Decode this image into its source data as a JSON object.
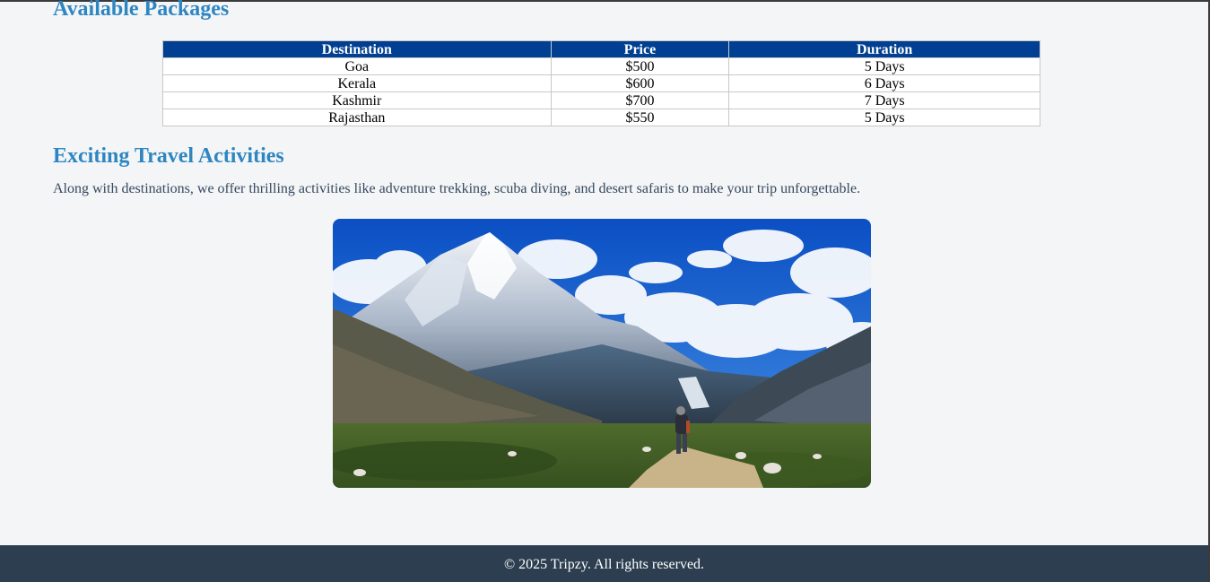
{
  "packages": {
    "title": "Available Packages",
    "columns": [
      "Destination",
      "Price",
      "Duration"
    ],
    "rows": [
      {
        "destination": "Goa",
        "price": "$500",
        "duration": "5 Days"
      },
      {
        "destination": "Kerala",
        "price": "$600",
        "duration": "6 Days"
      },
      {
        "destination": "Kashmir",
        "price": "$700",
        "duration": "7 Days"
      },
      {
        "destination": "Rajasthan",
        "price": "$550",
        "duration": "5 Days"
      }
    ],
    "colors": {
      "header_bg": "#003f91",
      "header_text": "#ffffff",
      "border": "#c8c8c8"
    }
  },
  "activities": {
    "title": "Exciting Travel Activities",
    "description": "Along with destinations, we offer thrilling activities like adventure trekking, scuba diving, and desert safaris to make your trip unforgettable.",
    "image_subject": "hiker on mountain trail with snowy peak"
  },
  "footer": {
    "text": "© 2025 Tripzy. All rights reserved."
  },
  "theme": {
    "heading_color": "#2e86c1",
    "page_bg": "#f4f5f7",
    "footer_bg": "#2c3e50"
  }
}
